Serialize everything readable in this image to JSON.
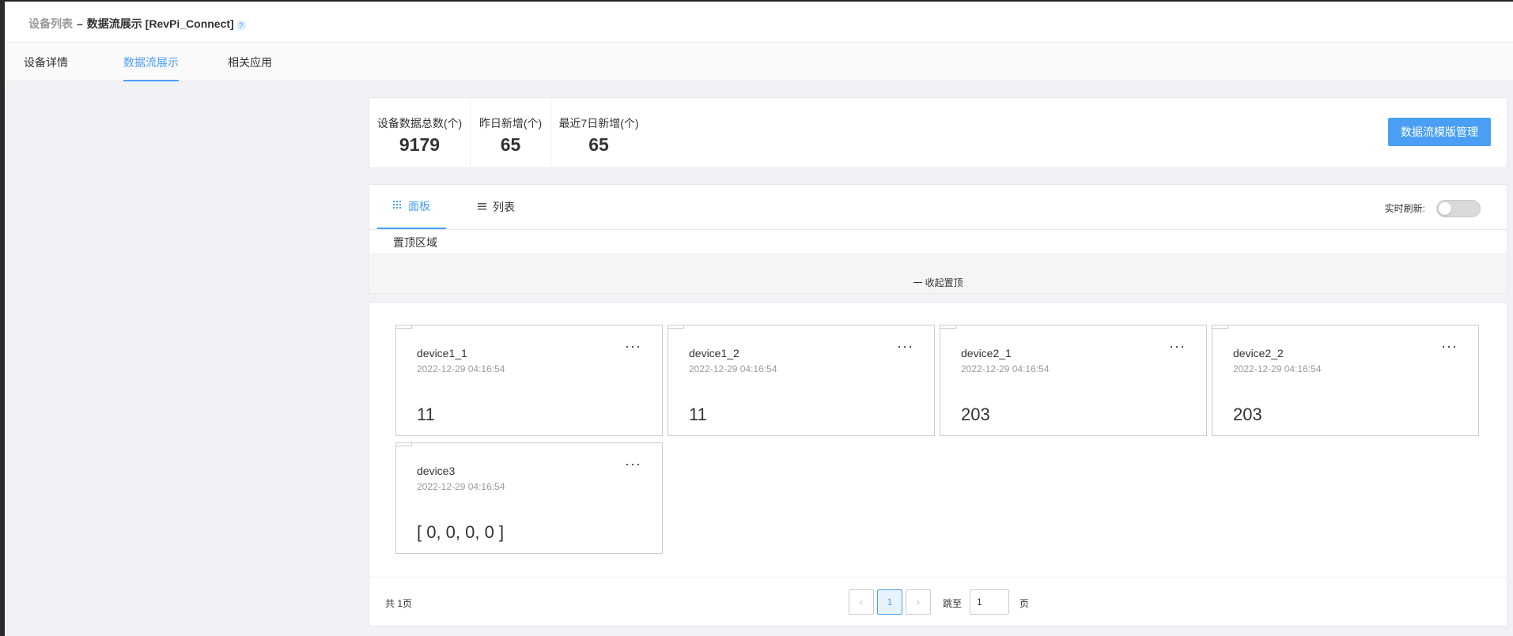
{
  "breadcrumb": {
    "root": "设备列表",
    "separator": "–",
    "current": "数据流展示 [RevPi_Connect]",
    "help": "?"
  },
  "top_tabs": [
    {
      "label": "设备详情",
      "active": false
    },
    {
      "label": "数据流展示",
      "active": true
    },
    {
      "label": "相关应用",
      "active": false
    }
  ],
  "stats": [
    {
      "label": "设备数据总数(个)",
      "value": "9179"
    },
    {
      "label": "昨日新增(个)",
      "value": "65"
    },
    {
      "label": "最近7日新增(个)",
      "value": "65"
    }
  ],
  "manage_button": "数据流模版管理",
  "view_tabs": [
    {
      "label": "面板",
      "icon": "grid-icon",
      "active": true
    },
    {
      "label": "列表",
      "icon": "list-icon",
      "active": false
    }
  ],
  "realtime_refresh": {
    "label": "实时刷新:",
    "enabled": false
  },
  "pinned": {
    "label": "置顶区域",
    "collapse": "一 收起置顶"
  },
  "devices": [
    {
      "name": "device1_1",
      "time": "2022-12-29 04:16:54",
      "value": "11"
    },
    {
      "name": "device1_2",
      "time": "2022-12-29 04:16:54",
      "value": "11"
    },
    {
      "name": "device2_1",
      "time": "2022-12-29 04:16:54",
      "value": "203"
    },
    {
      "name": "device2_2",
      "time": "2022-12-29 04:16:54",
      "value": "203"
    },
    {
      "name": "device3",
      "time": "2022-12-29 04:16:54",
      "value": "[ 0, 0, 0, 0 ]"
    }
  ],
  "more_glyph": "···",
  "pagination": {
    "total": "共 1页",
    "prev": "‹",
    "current": "1",
    "next": "›",
    "jump_label": "跳至",
    "jump_value": "1",
    "page_label": "页"
  },
  "colors": {
    "accent": "#4a9ff5",
    "background": "#f0f2f5"
  }
}
